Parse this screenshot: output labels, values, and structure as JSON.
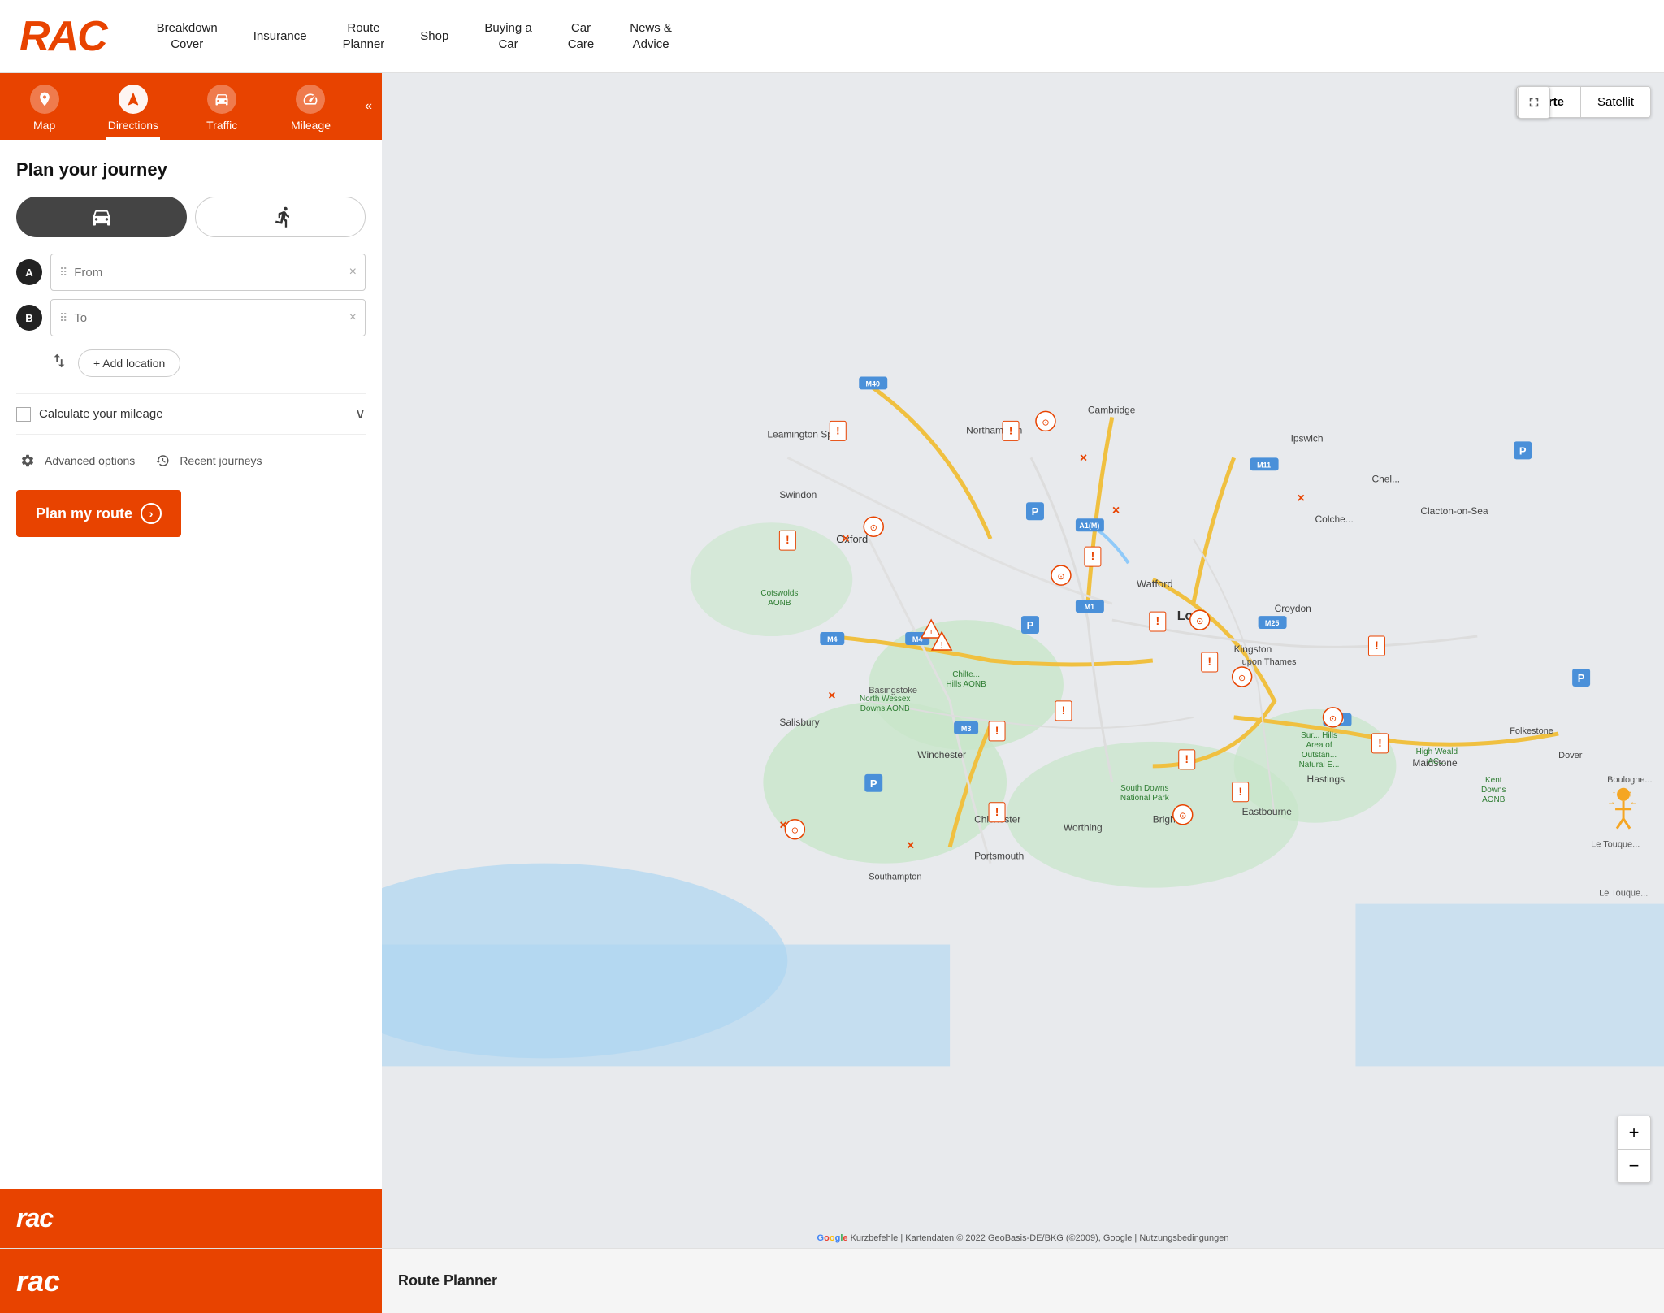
{
  "header": {
    "logo": "RAC",
    "nav": [
      {
        "label": "Breakdown\nCover",
        "id": "breakdown-cover"
      },
      {
        "label": "Insurance",
        "id": "insurance"
      },
      {
        "label": "Route\nPlanner",
        "id": "route-planner"
      },
      {
        "label": "Shop",
        "id": "shop"
      },
      {
        "label": "Buying a\nCar",
        "id": "buying-car"
      },
      {
        "label": "Car\nCare",
        "id": "car-care"
      },
      {
        "label": "News &\nAdvice",
        "id": "news-advice"
      }
    ]
  },
  "tabs": [
    {
      "label": "Map",
      "icon": "📍",
      "id": "map"
    },
    {
      "label": "Directions",
      "icon": "▲",
      "id": "directions",
      "active": true
    },
    {
      "label": "Traffic",
      "icon": "🚗",
      "id": "traffic"
    },
    {
      "label": "Mileage",
      "icon": "⊙",
      "id": "mileage"
    }
  ],
  "form": {
    "title": "Plan your journey",
    "mode_car_label": "🚗",
    "mode_walk_label": "🚶",
    "from_placeholder": "From",
    "to_placeholder": "To",
    "add_location_label": "+ Add location",
    "mileage_label": "Calculate your mileage",
    "advanced_options_label": "Advanced options",
    "recent_journeys_label": "Recent journeys",
    "plan_route_label": "Plan my route"
  },
  "map": {
    "toggle_karte": "Karte",
    "toggle_satellit": "Satellit",
    "attribution": "Kurzbefehle | Kartendaten © 2022 GeoBasis-DE/BKG (©2009), Google | Nutzungsbedingungen"
  },
  "footer": {
    "logo": "rac",
    "banner_text": "Route Planner"
  }
}
